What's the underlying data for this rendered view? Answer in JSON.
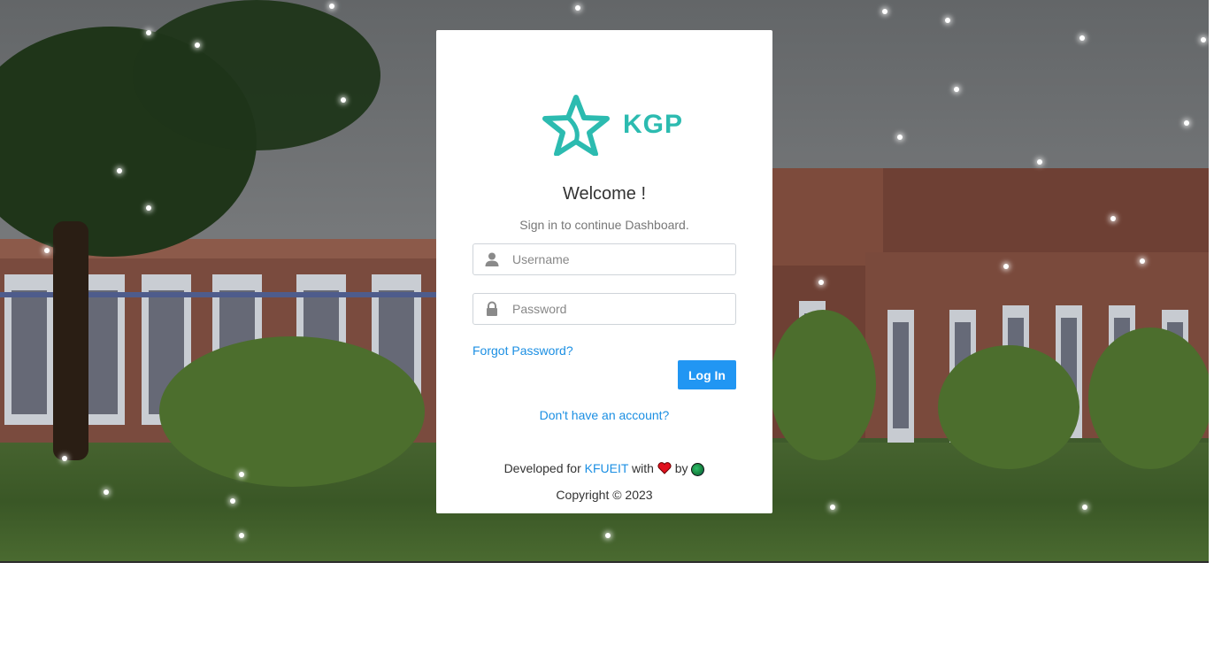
{
  "brand": {
    "logo_text": "KGP",
    "accent_color": "#2cbbb0"
  },
  "login": {
    "welcome": "Welcome !",
    "subtitle": "Sign in to continue Dashboard.",
    "username_placeholder": "Username",
    "password_placeholder": "Password",
    "forgot_label": "Forgot Password?",
    "login_label": "Log In",
    "signup_label": "Don't have an account?"
  },
  "footer": {
    "developed_prefix": "Developed for",
    "developed_org": "KFUEIT",
    "with_text": "with",
    "by_text": "by",
    "copyright": "Copyright © 2023"
  },
  "icons": {
    "username": "user-icon",
    "password": "lock-icon",
    "heart": "heart-icon",
    "globe": "globe-icon"
  },
  "colors": {
    "primary_button": "#2196f3",
    "link": "#1b8fe3"
  }
}
